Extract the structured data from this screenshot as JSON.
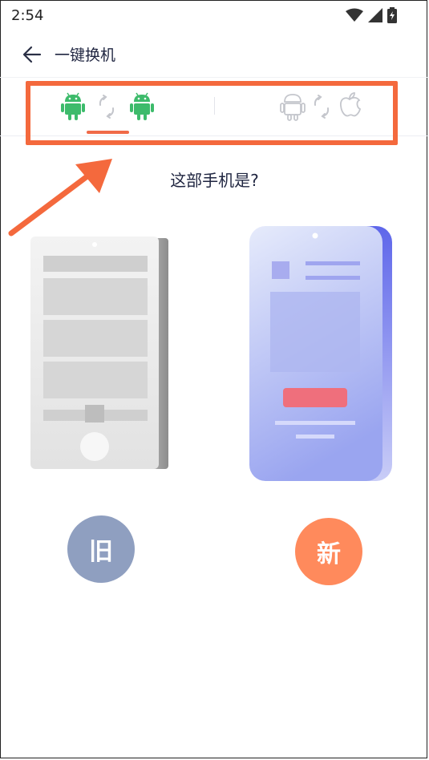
{
  "status_bar": {
    "time": "2:54",
    "icons": [
      "wifi-icon",
      "signal-icon",
      "battery-charging-icon"
    ]
  },
  "toolbar": {
    "back_icon": "arrow-left-icon",
    "title": "一键换机"
  },
  "tabs": [
    {
      "id": "android-to-android",
      "icons": [
        "android-icon",
        "transfer-arrows-icon",
        "android-icon"
      ],
      "selected": true
    },
    {
      "id": "android-to-iphone",
      "icons": [
        "android-icon",
        "transfer-arrows-icon",
        "apple-icon"
      ],
      "selected": false
    }
  ],
  "question": "这部手机是?",
  "options": {
    "old": {
      "badge": "旧"
    },
    "new": {
      "badge": "新"
    }
  },
  "colors": {
    "accent": "#f06a48",
    "android_active": "#3dbb6b",
    "icon_inactive": "#c4c6cc",
    "highlight": "#f4693d",
    "badge_old": "#8f9fc0",
    "badge_new": "#ff8a5c",
    "new_phone": "#6f78f0"
  }
}
